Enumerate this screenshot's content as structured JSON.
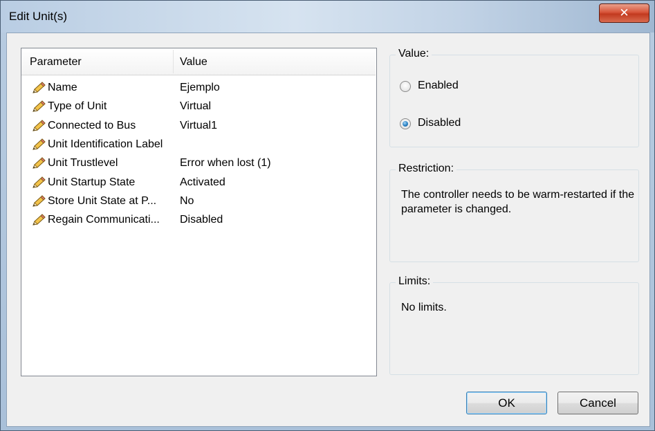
{
  "window": {
    "title": "Edit Unit(s)",
    "close_glyph": "✕"
  },
  "list": {
    "columns": [
      "Parameter",
      "Value"
    ],
    "rows": [
      {
        "parameter": "Name",
        "value": "Ejemplo"
      },
      {
        "parameter": "Type of Unit",
        "value": "Virtual"
      },
      {
        "parameter": "Connected to Bus",
        "value": "Virtual1"
      },
      {
        "parameter": "Unit Identification Label",
        "value": ""
      },
      {
        "parameter": "Unit Trustlevel",
        "value": "Error when lost (1)"
      },
      {
        "parameter": "Unit Startup State",
        "value": "Activated"
      },
      {
        "parameter": "Store Unit State at P...",
        "value": "No"
      },
      {
        "parameter": "Regain Communicati...",
        "value": "Disabled"
      }
    ],
    "row_icon": "pencil-icon"
  },
  "value_group": {
    "label": "Value:",
    "options": [
      {
        "label": "Enabled",
        "selected": false
      },
      {
        "label": "Disabled",
        "selected": true
      }
    ]
  },
  "restriction_group": {
    "label": "Restriction:",
    "text": "The controller needs to be warm-restarted if the parameter is changed."
  },
  "limits_group": {
    "label": "Limits:",
    "text": "No limits."
  },
  "buttons": {
    "ok": "OK",
    "cancel": "Cancel"
  },
  "colors": {
    "accent": "#3c7fb1",
    "close": "#c23a1f"
  }
}
